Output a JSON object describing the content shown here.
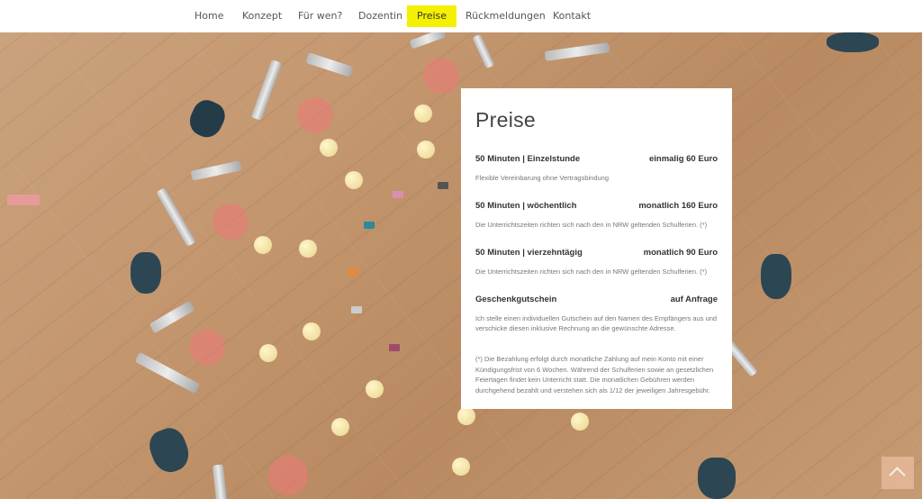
{
  "nav": {
    "items": [
      {
        "label": "Home"
      },
      {
        "label": "Konzept"
      },
      {
        "label": "Für wen?"
      },
      {
        "label": "Dozentin"
      },
      {
        "label": "Preise",
        "active": true
      },
      {
        "label": "Rückmeldungen"
      },
      {
        "label": "Kontakt"
      }
    ],
    "active_color": "#f4f000"
  },
  "card": {
    "title": "Preise",
    "rows": [
      {
        "name": "50 Minuten | Einzelstunde",
        "price": "einmalig 60 Euro",
        "desc": "Flexible Vereinbarung ohne Vertragsbindung"
      },
      {
        "name": "50 Minuten | wöchentlich",
        "price": "monatlich 160 Euro",
        "desc": "Die Unterrichtszeiten richten sich nach den in NRW geltenden Schulferien. (*)"
      },
      {
        "name": "50 Minuten | vierzehntägig",
        "price": "monatlich 90 Euro",
        "desc": "Die Unterrichtszeiten richten sich nach den in NRW geltenden Schulferien. (*)"
      },
      {
        "name": "Geschenkgutschein",
        "price": "auf Anfrage",
        "desc": "Ich stelle einen individuellen Gutschein auf den Namen des Empfängers aus und verschicke diesen inklusive Rechnung an die gewünschte Adresse."
      }
    ],
    "footnote": "(*) Die Bezahlung erfolgt durch monatliche Zahlung auf mein Konto mit einer Kündigungsfrist von 6 Wochen. Während der Schulferien sowie an gesetzlichen Feiertagen findet kein Unterricht statt. Die monatlichen Gebühren werden durchgehend bezahlt und verstehen sich als 1/12 der jeweiligen Jahresgebühr."
  },
  "scroll_top": {
    "icon": "chevron-up-icon"
  }
}
